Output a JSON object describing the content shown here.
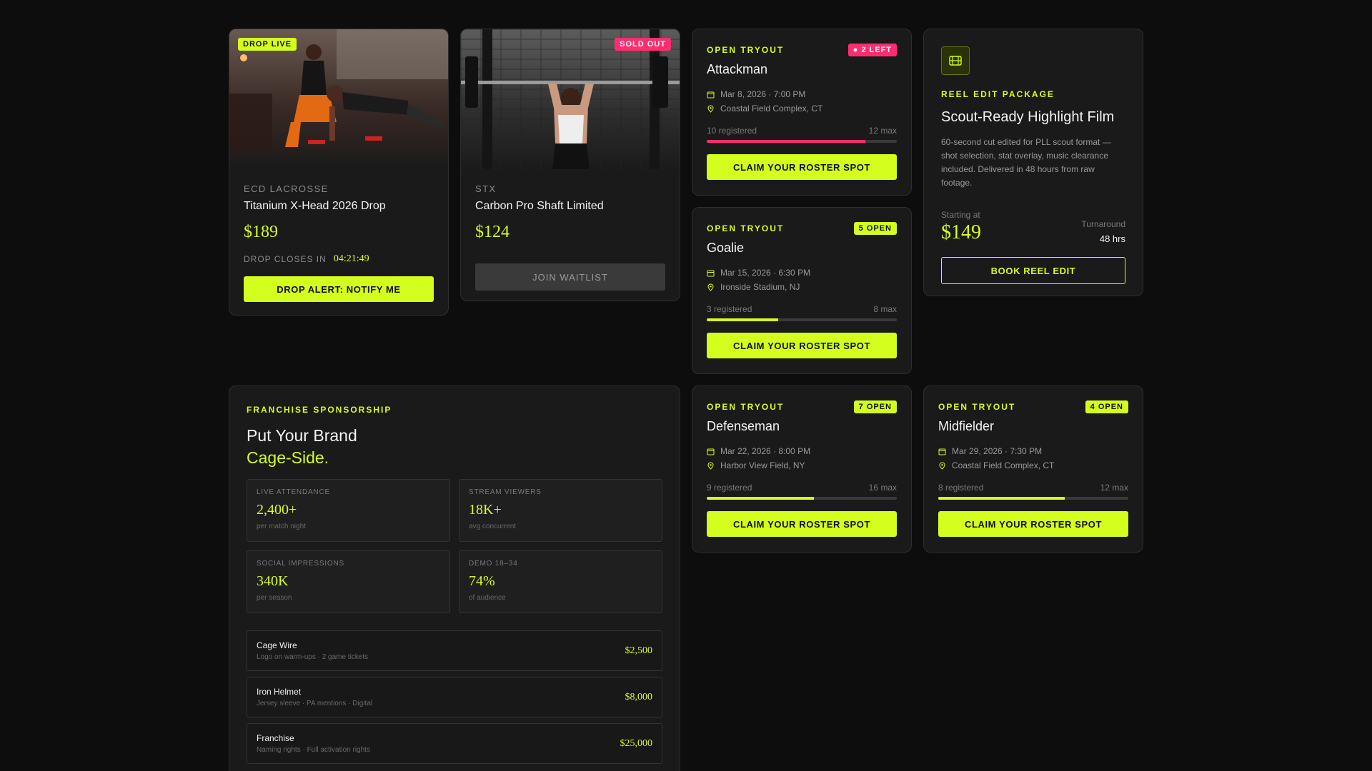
{
  "products": [
    {
      "badge": "DROP LIVE",
      "brand": "ECD LACROSSE",
      "name": "Titanium X-Head 2026 Drop",
      "price": "$189",
      "closes_label": "DROP CLOSES IN",
      "timer": "04:21:49",
      "cta": "DROP ALERT: NOTIFY ME"
    },
    {
      "badge": "SOLD OUT",
      "brand": "STX",
      "name": "Carbon Pro Shaft Limited",
      "price": "$124",
      "cta": "JOIN WAITLIST"
    }
  ],
  "tryouts": [
    {
      "label": "OPEN TRYOUT",
      "badge": "● 2 LEFT",
      "title": "Attackman",
      "date": "Mar 8, 2026 · 7:00 PM",
      "location": "Coastal Field Complex, CT",
      "registered": "10 registered",
      "max": "12 max",
      "fill": 0.833,
      "cta": "CLAIM YOUR ROSTER SPOT"
    },
    {
      "label": "OPEN TRYOUT",
      "badge": "5 OPEN",
      "title": "Goalie",
      "date": "Mar 15, 2026 · 6:30 PM",
      "location": "Ironside Stadium, NJ",
      "registered": "3 registered",
      "max": "8 max",
      "fill": 0.375,
      "cta": "CLAIM YOUR ROSTER SPOT"
    },
    {
      "label": "OPEN TRYOUT",
      "badge": "7 OPEN",
      "title": "Defenseman",
      "date": "Mar 22, 2026 · 8:00 PM",
      "location": "Harbor View Field, NY",
      "registered": "9 registered",
      "max": "16 max",
      "fill": 0.5625,
      "cta": "CLAIM YOUR ROSTER SPOT"
    },
    {
      "label": "OPEN TRYOUT",
      "badge": "4 OPEN",
      "title": "Midfielder",
      "date": "Mar 29, 2026 · 7:30 PM",
      "location": "Coastal Field Complex, CT",
      "registered": "8 registered",
      "max": "12 max",
      "fill": 0.667,
      "cta": "CLAIM YOUR ROSTER SPOT"
    }
  ],
  "reel": {
    "label": "REEL EDIT PACKAGE",
    "title": "Scout-Ready Highlight Film",
    "description": "60-second cut edited for PLL scout format — shot selection, stat overlay, music clearance included. Delivered in 48 hours from raw footage.",
    "starting_label": "Starting at",
    "price": "$149",
    "turnaround_label": "Turnaround",
    "turnaround": "48 hrs",
    "cta": "BOOK REEL EDIT"
  },
  "sponsorship": {
    "label": "FRANCHISE SPONSORSHIP",
    "title_line1": "Put Your Brand",
    "title_line2": "Cage-Side.",
    "stats": [
      {
        "key": "LIVE ATTENDANCE",
        "value": "2,400+",
        "sub": "per match night"
      },
      {
        "key": "STREAM VIEWERS",
        "value": "18K+",
        "sub": "avg concurrent"
      },
      {
        "key": "SOCIAL IMPRESSIONS",
        "value": "340K",
        "sub": "per season"
      },
      {
        "key": "DEMO 18–34",
        "value": "74%",
        "sub": "of audience"
      }
    ],
    "tiers": [
      {
        "name": "Cage Wire",
        "desc": "Logo on warm-ups · 2 game tickets",
        "price": "$2,500"
      },
      {
        "name": "Iron Helmet",
        "desc": "Jersey sleeve · PA mentions · Digital",
        "price": "$8,000"
      },
      {
        "name": "Franchise",
        "desc": "Naming rights · Full activation rights",
        "price": "$25,000"
      }
    ]
  },
  "colors": {
    "accent": "#d4ff1e",
    "alert": "#ff2d6f",
    "card": "#1a1a1a",
    "bg": "#0d0d0d"
  }
}
